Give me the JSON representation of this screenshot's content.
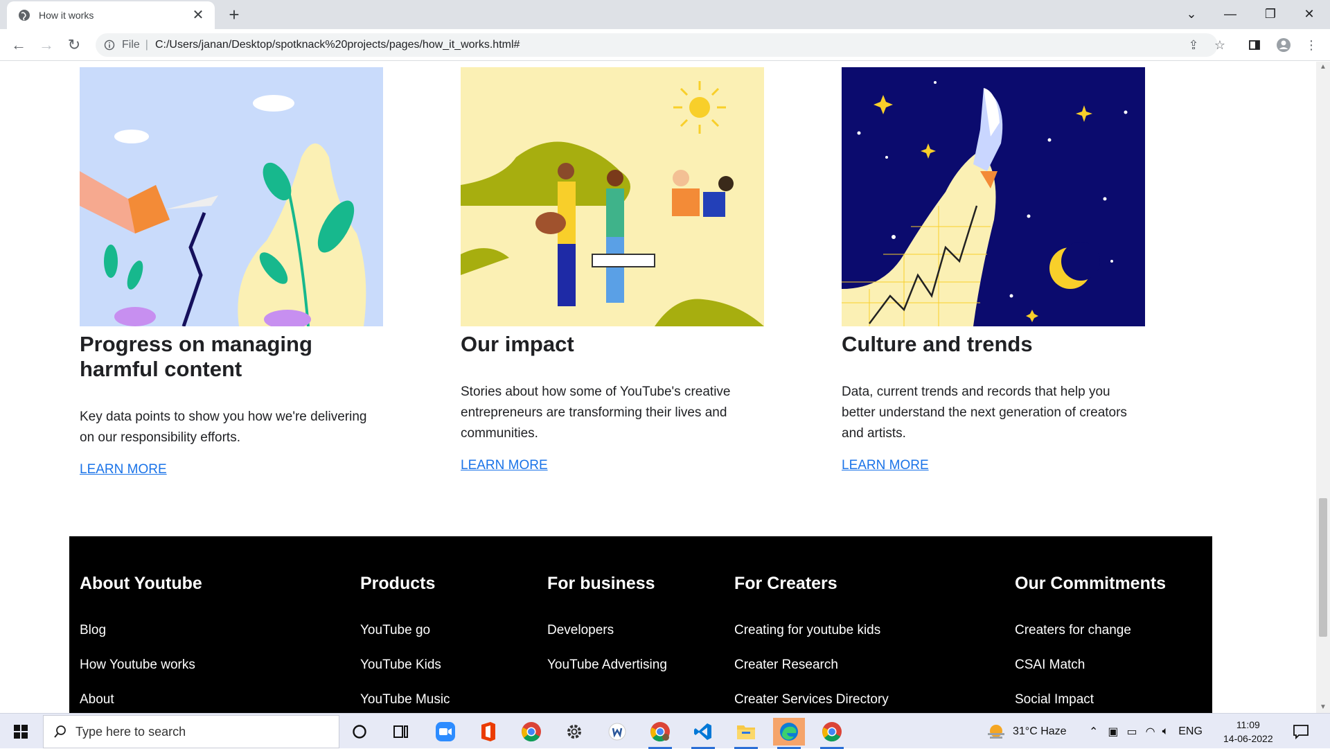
{
  "browser": {
    "tab_title": "How it works",
    "tab_close": "✕",
    "new_tab": "+",
    "file_label": "File",
    "url": "C:/Users/janan/Desktop/spotknack%20projects/pages/how_it_works.html#"
  },
  "cards": [
    {
      "title": "Progress on managing harmful content",
      "description": "Key data points to show you how we're delivering on our responsibility efforts.",
      "link": "LEARN MORE"
    },
    {
      "title": "Our impact",
      "description": "Stories about how some of YouTube's creative entrepreneurs are transforming their lives and communities.",
      "link": "LEARN MORE"
    },
    {
      "title": "Culture and trends",
      "description": "Data, current trends and records that help you better understand the next generation of creators and artists.",
      "link": "LEARN MORE"
    }
  ],
  "footer": {
    "columns": [
      {
        "heading": "About Youtube",
        "items": [
          "Blog",
          "How Youtube works",
          "About"
        ]
      },
      {
        "heading": "Products",
        "items": [
          "YouTube go",
          "YouTube Kids",
          "YouTube Music"
        ]
      },
      {
        "heading": "For business",
        "items": [
          "Developers",
          "YouTube Advertising"
        ]
      },
      {
        "heading": "For Creaters",
        "items": [
          "Creating for youtube kids",
          "Creater Research",
          "Creater Services Directory"
        ]
      },
      {
        "heading": "Our Commitments",
        "items": [
          "Creaters for change",
          "CSAI Match",
          "Social Impact"
        ]
      }
    ]
  },
  "taskbar": {
    "search_placeholder": "Type here to search",
    "weather": "31°C  Haze",
    "language": "ENG",
    "time": "11:09",
    "date": "14-06-2022"
  },
  "colors": {
    "link": "#1a73e8",
    "footer_bg": "#000000",
    "card1_bg": "#c9dbfb",
    "card2_bg": "#fbf0b4",
    "card3_bg": "#0b0b6e"
  }
}
